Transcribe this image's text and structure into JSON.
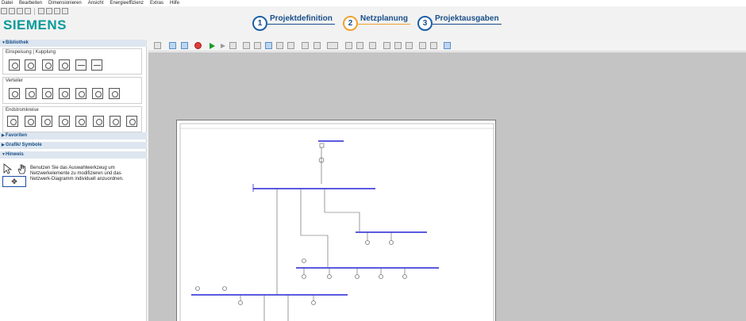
{
  "menu": [
    "Datei",
    "Bearbeiten",
    "Dimensionieren",
    "Ansicht",
    "Energieeffizienz",
    "Extras",
    "Hilfe"
  ],
  "logo": "SIEMENS",
  "steps": [
    {
      "num": "1",
      "label": "Projektdefinition"
    },
    {
      "num": "2",
      "label": "Netzplanung",
      "active": true
    },
    {
      "num": "3",
      "label": "Projektausgaben"
    }
  ],
  "sidebar": {
    "bibliothek": "Bibliothek",
    "groups": {
      "einspeisung": "Einspeisung | Kupplung",
      "verteiler": "Verteiler",
      "endstrom": "Endstromkreise"
    },
    "favoriten": "Favoriten",
    "grafik": "Grafik/ Symbole",
    "hinweis": "Hinweis",
    "hint_text": "Benutzen Sie das Auswahlwerkzeug um Netzwerkelemente zu modifizieren und das Netzwerk-Diagramm individuell anzuordnen.",
    "move_glyph": "✥"
  },
  "colors": {
    "accent": "#1a4f8a",
    "active_step": "#f0a030",
    "logo": "#0a9a9a",
    "busbar": "#2323d6",
    "canvas_bg": "#c4c4c4"
  }
}
